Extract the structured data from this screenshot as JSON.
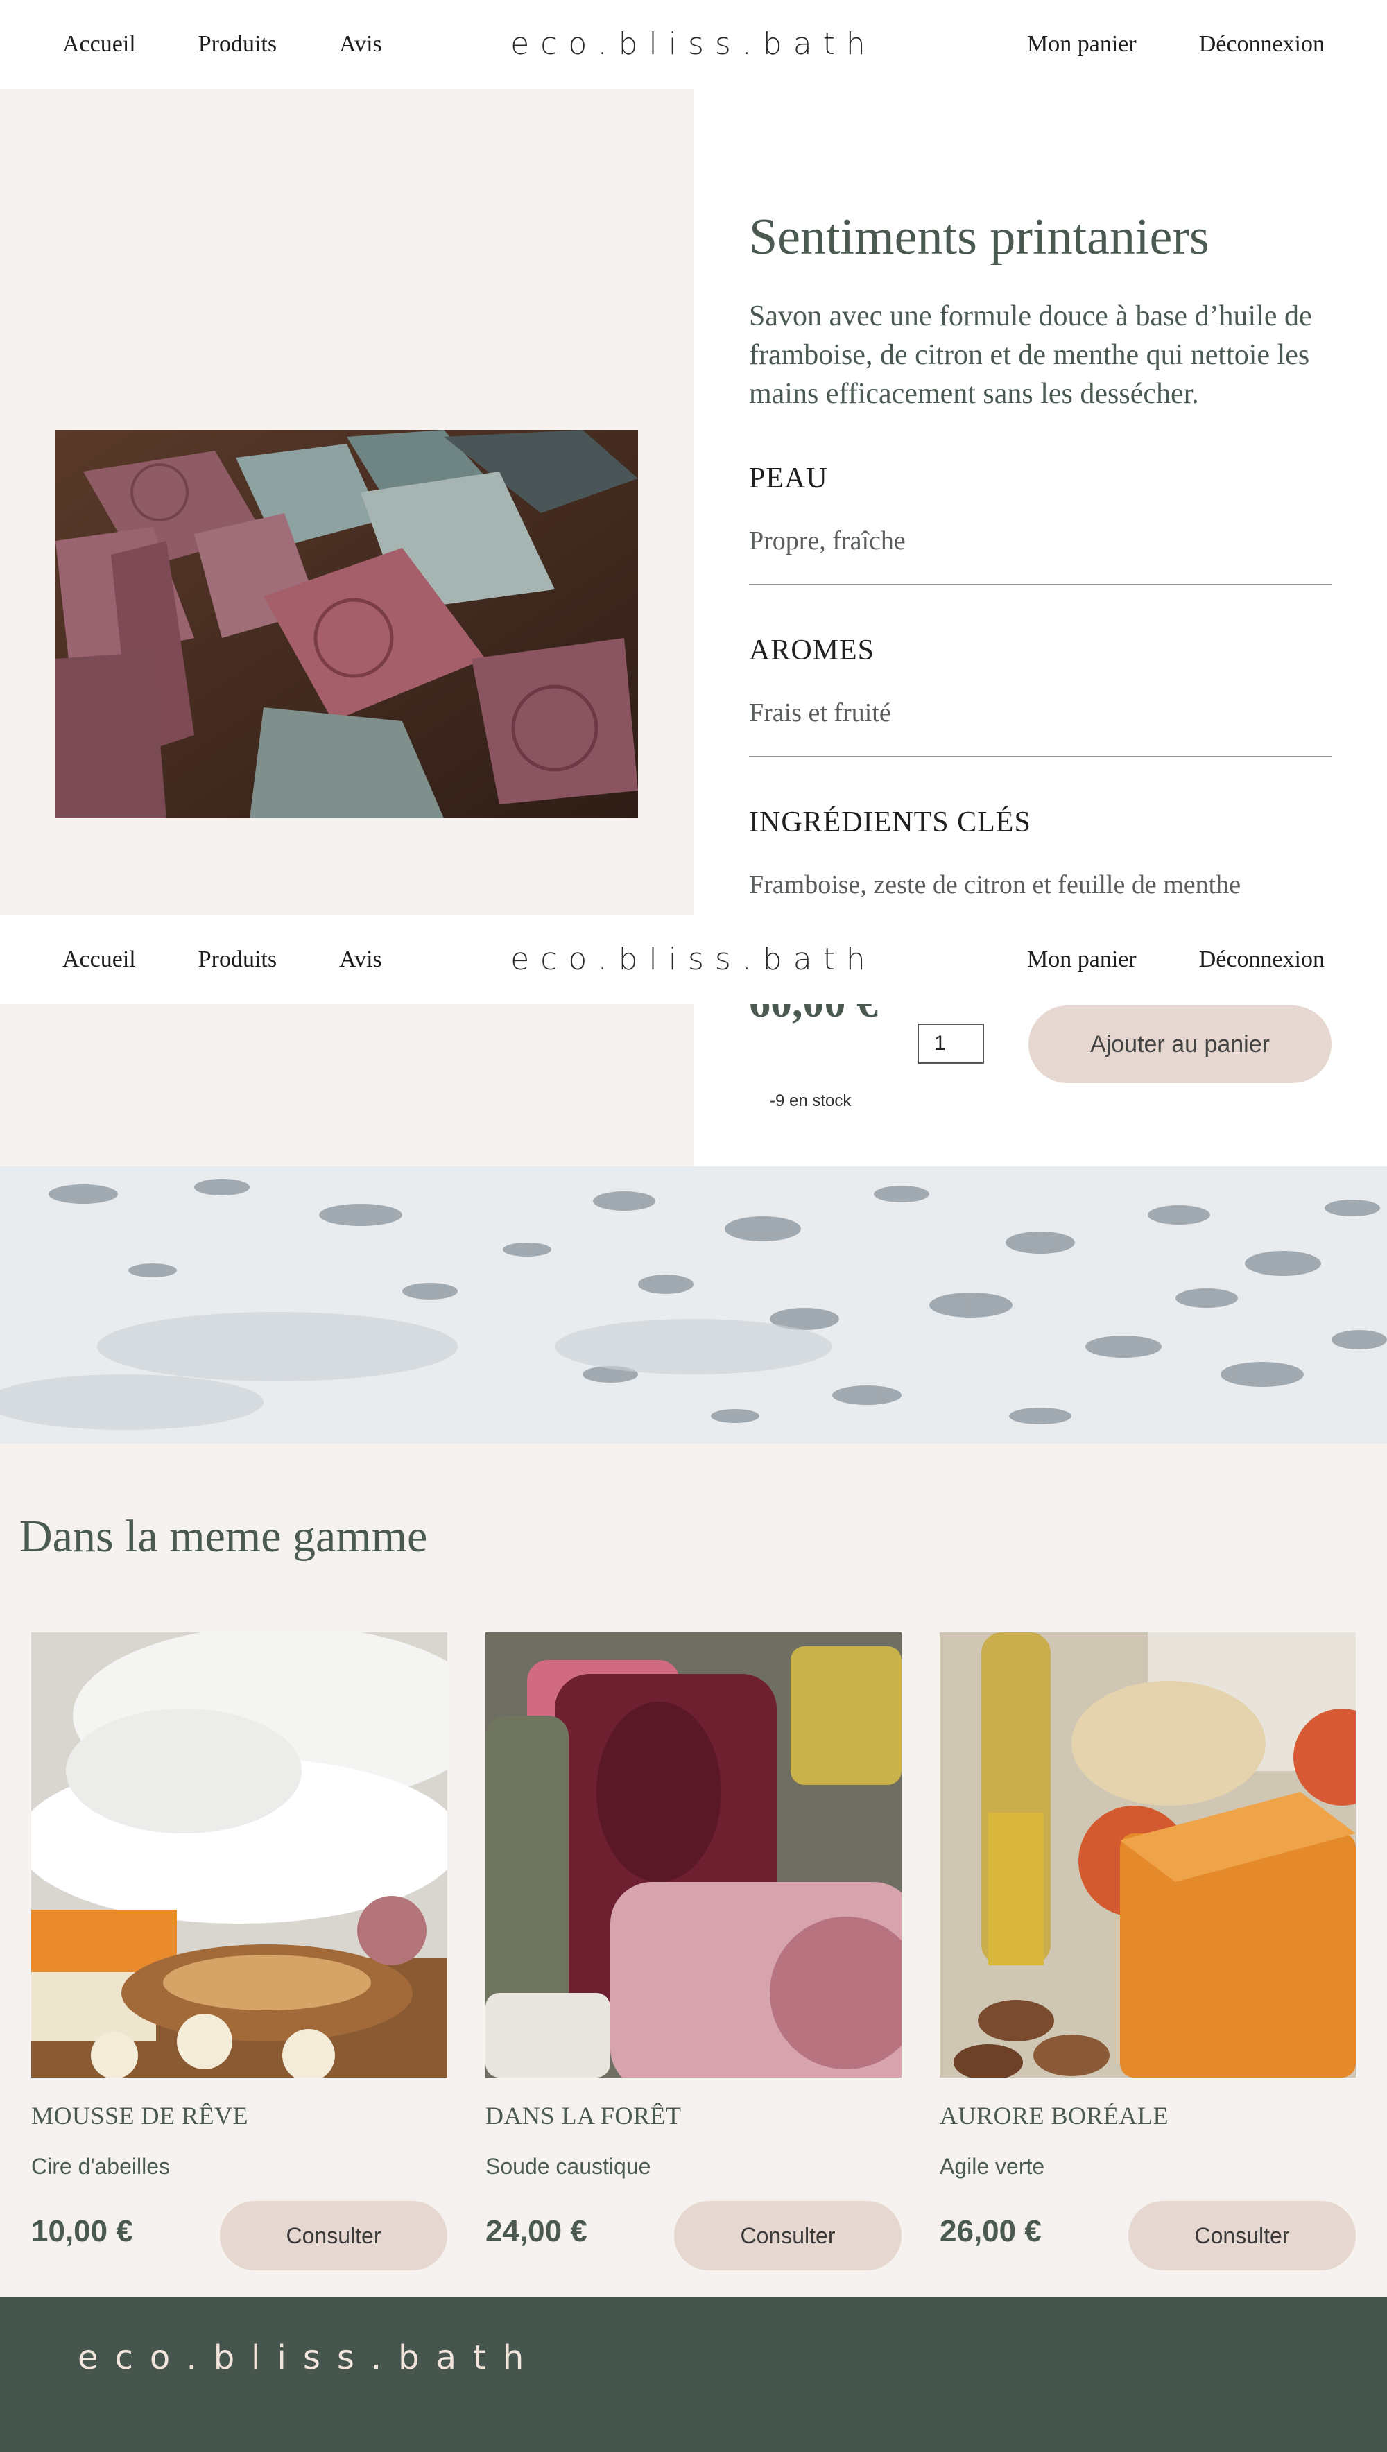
{
  "nav": {
    "brand": "eco.bliss.bath",
    "links_left": [
      "Accueil",
      "Produits",
      "Avis"
    ],
    "links_right": [
      "Mon panier",
      "Déconnexion"
    ]
  },
  "product": {
    "title": "Sentiments printaniers",
    "description": "Savon avec une formule douce à base d’huile de framboise, de citron et de menthe qui nettoie les mains efficacement sans les dessécher.",
    "sections": [
      {
        "heading": "PEAU",
        "value": "Propre, fraîche"
      },
      {
        "heading": "AROMES",
        "value": "Frais et fruité"
      },
      {
        "heading": "INGRÉDIENTS CLÉS",
        "value": "Framboise, zeste de citron et feuille de menthe"
      }
    ],
    "price": "60,00 €",
    "stock_text": "-9 en stock",
    "quantity": "1",
    "add_button": "Ajouter au panier"
  },
  "gamme": {
    "title": "Dans la meme gamme",
    "consult_label": "Consulter",
    "items": [
      {
        "name": "MOUSSE DE RÊVE",
        "sub": "Cire d'abeilles",
        "price": "10,00 €"
      },
      {
        "name": "DANS LA FORÊT",
        "sub": "Soude caustique",
        "price": "24,00 €"
      },
      {
        "name": "AURORE BORÉALE",
        "sub": "Agile verte",
        "price": "26,00 €"
      }
    ]
  },
  "footer": {
    "brand": "eco.bliss.bath"
  },
  "colors": {
    "accent_button": "#e6d8d0",
    "text_green": "#4a5a50",
    "footer_bg": "#46554e",
    "page_bg": "#f6f2ef"
  }
}
